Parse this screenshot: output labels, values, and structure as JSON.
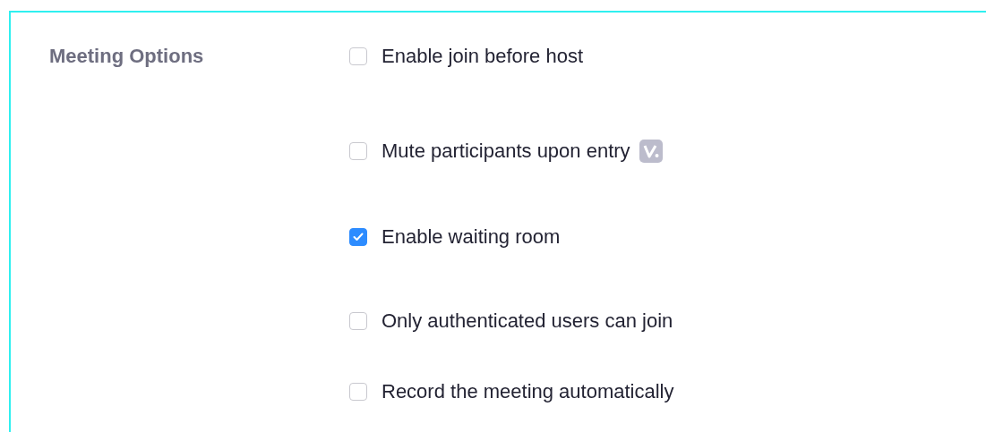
{
  "section": {
    "title": "Meeting Options"
  },
  "options": [
    {
      "label": "Enable join before host",
      "checked": false,
      "badge": false
    },
    {
      "label": "Mute participants upon entry",
      "checked": false,
      "badge": true
    },
    {
      "label": "Enable waiting room",
      "checked": true,
      "badge": false
    },
    {
      "label": "Only authenticated users can join",
      "checked": false,
      "badge": false
    },
    {
      "label": "Record the meeting automatically",
      "checked": false,
      "badge": false
    }
  ]
}
